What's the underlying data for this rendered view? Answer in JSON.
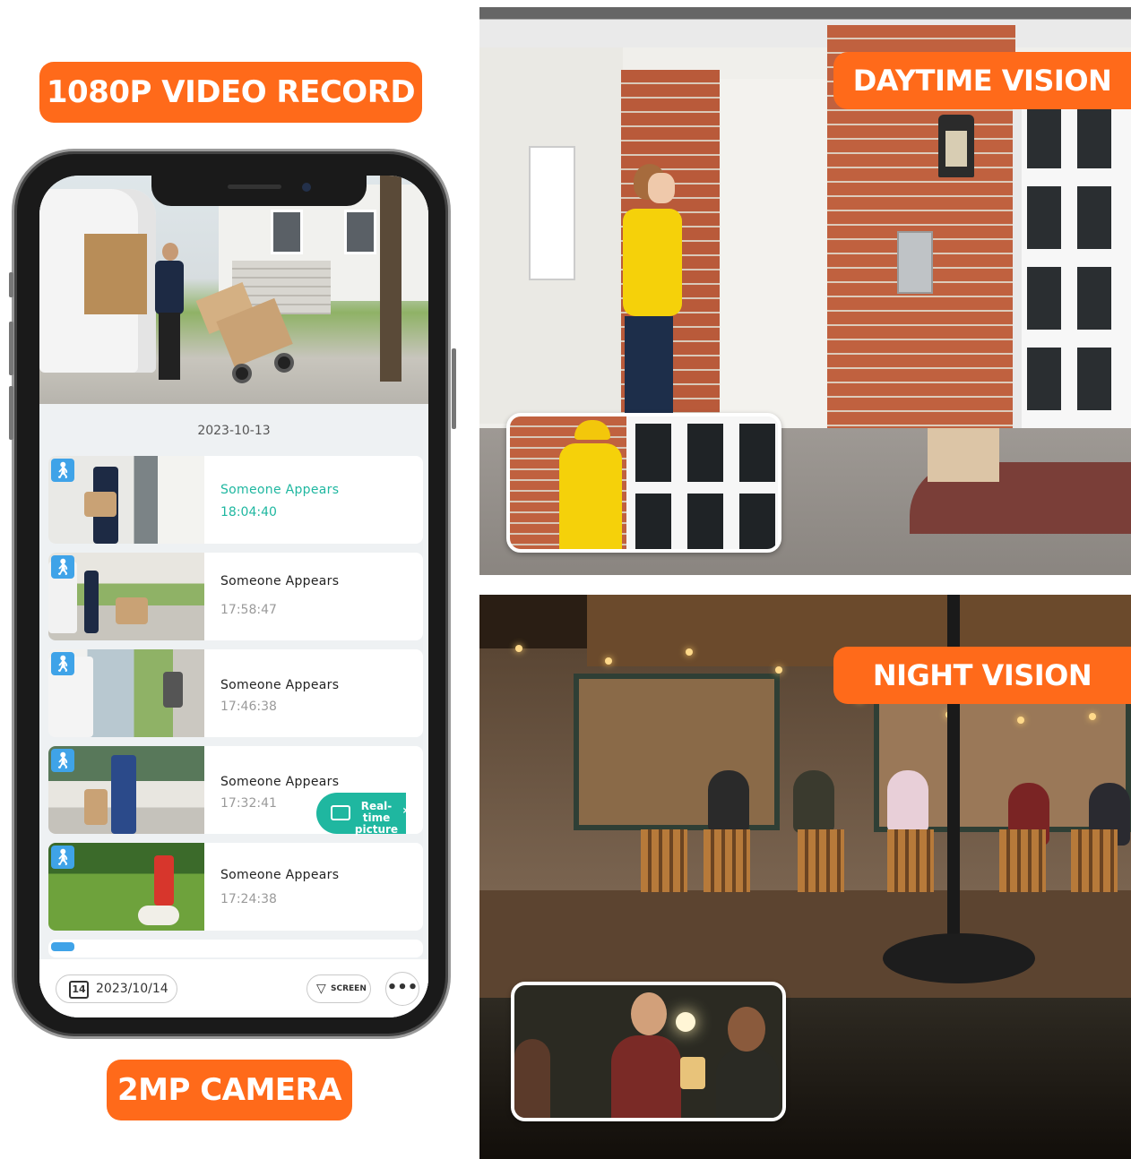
{
  "banners": {
    "top": "1080P VIDEO RECORD",
    "bottom": "2MP CAMERA",
    "day": "DAYTIME VISION",
    "night": "NIGHT VISION"
  },
  "app": {
    "date_header": "2023-10-13",
    "events": [
      {
        "title": "Someone Appears",
        "time": "18:04:40",
        "active": true
      },
      {
        "title": "Someone Appears",
        "time": "17:58:47",
        "active": false
      },
      {
        "title": "Someone Appears",
        "time": "17:46:38",
        "active": false
      },
      {
        "title": "Someone Appears",
        "time": "17:32:41",
        "active": false
      },
      {
        "title": "Someone Appears",
        "time": "17:24:38",
        "active": false
      }
    ],
    "realtime_button": {
      "line1": "Real-time",
      "line2": "picture",
      "icon": "camera-icon"
    },
    "bottom_bar": {
      "calendar_day": "14",
      "date": "2023/10/14",
      "screen_label": "SCREEN",
      "more_label": "•••"
    }
  },
  "colors": {
    "banner_orange": "#ff6a1a",
    "accent_teal": "#1fb7a0",
    "motion_badge_blue": "#3fa3e8"
  }
}
